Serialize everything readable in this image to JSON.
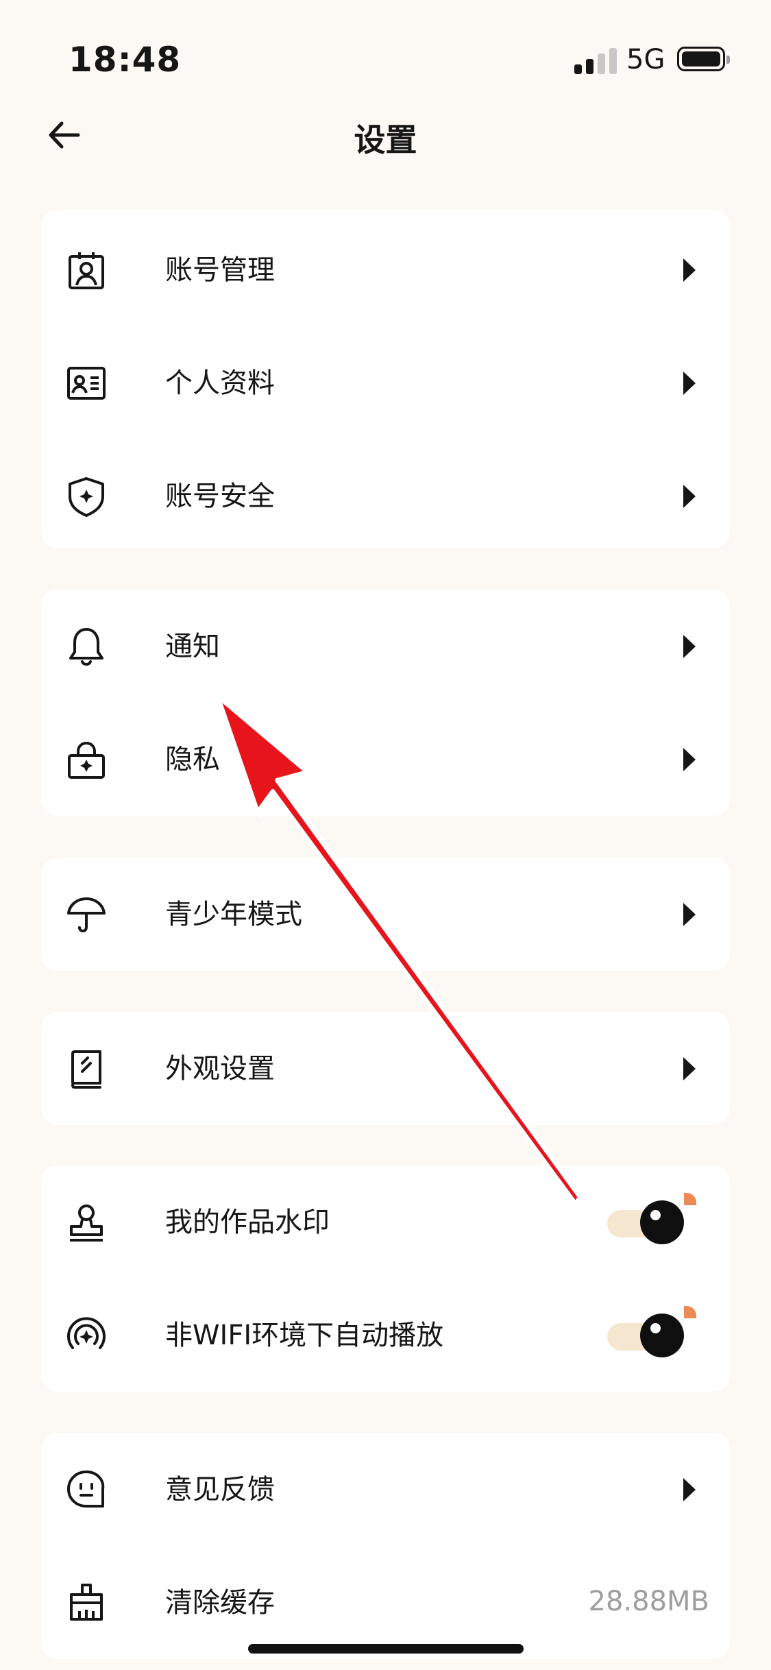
{
  "status_bar": {
    "time": "18:48",
    "network": "5G"
  },
  "header": {
    "title": "设置",
    "back_icon": "arrow-left-icon"
  },
  "groups": [
    {
      "items": [
        {
          "label": "账号管理",
          "icon": "id-badge-icon"
        },
        {
          "label": "个人资料",
          "icon": "profile-card-icon"
        },
        {
          "label": "账号安全",
          "icon": "shield-icon"
        }
      ]
    },
    {
      "items": [
        {
          "label": "通知",
          "icon": "bell-icon"
        },
        {
          "label": "隐私",
          "icon": "lock-icon"
        }
      ]
    },
    {
      "items": [
        {
          "label": "青少年模式",
          "icon": "umbrella-icon"
        }
      ]
    },
    {
      "items": [
        {
          "label": "外观设置",
          "icon": "book-icon"
        }
      ]
    },
    {
      "items": [
        {
          "label": "我的作品水印",
          "icon": "stamp-icon",
          "toggle_on": true
        },
        {
          "label": "非WIFI环境下自动播放",
          "icon": "broadcast-icon",
          "toggle_on": true
        }
      ]
    },
    {
      "items": [
        {
          "label": "意见反馈",
          "icon": "feedback-icon"
        },
        {
          "label": "清除缓存",
          "icon": "broom-icon",
          "value": "28.88MB"
        }
      ]
    }
  ],
  "colors": {
    "background": "#fcf9f4",
    "toggle_track": "#f5e6cf",
    "toggle_accent": "#ee8a54",
    "annotation_arrow": "#e8141c"
  }
}
